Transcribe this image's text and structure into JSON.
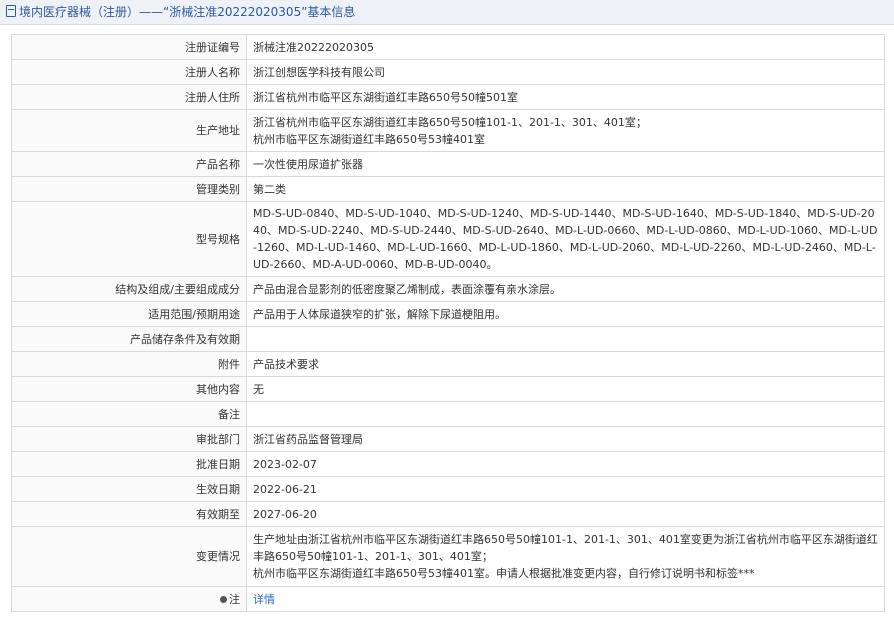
{
  "header": {
    "title": "境内医疗器械（注册）——“浙械注准20222020305”基本信息",
    "icon": "document-icon"
  },
  "rows": [
    {
      "label": "注册证编号",
      "value": "浙械注准20222020305"
    },
    {
      "label": "注册人名称",
      "value": "浙江创想医学科技有限公司"
    },
    {
      "label": "注册人住所",
      "value": "浙江省杭州市临平区东湖街道红丰路650号50幢501室"
    },
    {
      "label": "生产地址",
      "value_lines": [
        "浙江省杭州市临平区东湖街道红丰路650号50幢101-1、201-1、301、401室；",
        "杭州市临平区东湖街道红丰路650号53幢401室"
      ]
    },
    {
      "label": "产品名称",
      "value": "一次性使用尿道扩张器"
    },
    {
      "label": "管理类别",
      "value": "第二类"
    },
    {
      "label": "型号规格",
      "value": "MD-S-UD-0840、MD-S-UD-1040、MD-S-UD-1240、MD-S-UD-1440、MD-S-UD-1640、MD-S-UD-1840、MD-S-UD-2040、MD-S-UD-2240、MD-S-UD-2440、MD-S-UD-2640、MD-L-UD-0660、MD-L-UD-0860、MD-L-UD-1060、MD-L-UD-1260、MD-L-UD-1460、MD-L-UD-1660、MD-L-UD-1860、MD-L-UD-2060、MD-L-UD-2260、MD-L-UD-2460、MD-L-UD-2660、MD-A-UD-0060、MD-B-UD-0040。"
    },
    {
      "label": "结构及组成/主要组成成分",
      "value": "产品由混合显影剂的低密度聚乙烯制成，表面涂覆有亲水涂层。"
    },
    {
      "label": "适用范围/预期用途",
      "value": "产品用于人体尿道狭窄的扩张，解除下尿道梗阻用。"
    },
    {
      "label": "产品储存条件及有效期",
      "value": ""
    },
    {
      "label": "附件",
      "value": "产品技术要求"
    },
    {
      "label": "其他内容",
      "value": "无"
    },
    {
      "label": "备注",
      "value": ""
    },
    {
      "label": "审批部门",
      "value": "浙江省药品监督管理局"
    },
    {
      "label": "批准日期",
      "value": "2023-02-07"
    },
    {
      "label": "生效日期",
      "value": "2022-06-21"
    },
    {
      "label": "有效期至",
      "value": "2027-06-20"
    },
    {
      "label": "变更情况",
      "value_lines": [
        "生产地址由浙江省杭州市临平区东湖街道红丰路650号50幢101-1、201-1、301、401室变更为浙江省杭州市临平区东湖街道红丰路650号50幢101-1、201-1、301、401室；",
        "杭州市临平区东湖街道红丰路650号53幢401室。申请人根据批准变更内容，自行修订说明书和标签***"
      ]
    },
    {
      "label": "注",
      "value": "详情",
      "icon": "bullet-icon"
    }
  ]
}
